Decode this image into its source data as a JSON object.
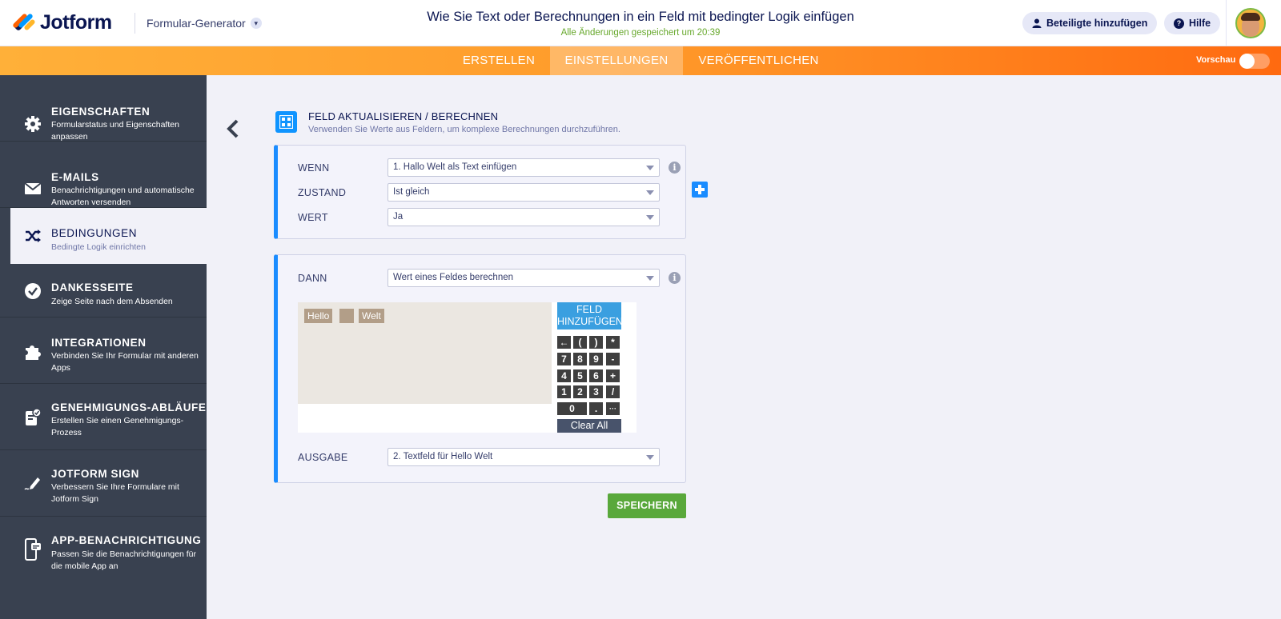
{
  "header": {
    "logo_text": "Jotform",
    "builder_label": "Formular-Generator",
    "form_title": "Wie Sie Text oder Berechnungen in ein Feld mit bedingter Logik einfügen",
    "saved_status": "Alle Änderungen gespeichert um 20:39",
    "add_participants": "Beteiligte hinzufügen",
    "help": "Hilfe"
  },
  "nav": {
    "tabs": [
      {
        "label": "ERSTELLEN",
        "active": false
      },
      {
        "label": "EINSTELLUNGEN",
        "active": true
      },
      {
        "label": "VERÖFFENTLICHEN",
        "active": false
      }
    ],
    "preview_label": "Vorschau",
    "preview_on": false
  },
  "sidebar": {
    "items": [
      {
        "title": "EIGENSCHAFTEN",
        "desc": "Formularstatus und Eigenschaften anpassen",
        "icon": "gear-icon"
      },
      {
        "title": "E-MAILS",
        "desc": "Benachrichtigungen und automatische Antworten versenden",
        "icon": "envelope-icon"
      },
      {
        "title": "BEDINGUNGEN",
        "desc": "Bedingte Logik einrichten",
        "icon": "shuffle-icon",
        "active": true
      },
      {
        "title": "DANKESSEITE",
        "desc": "Zeige Seite nach dem Absenden",
        "icon": "check-circle-icon"
      },
      {
        "title": "INTEGRATIONEN",
        "desc": "Verbinden Sie Ihr Formular mit anderen Apps",
        "icon": "puzzle-icon"
      },
      {
        "title": "GENEHMIGUNGS-ABLÄUFE",
        "desc": "Erstellen Sie einen Genehmigungs-Prozess",
        "icon": "approval-doc-icon"
      },
      {
        "title": "JOTFORM SIGN",
        "desc": "Verbessern Sie Ihre Formulare mit Jotform Sign",
        "icon": "pen-sign-icon"
      },
      {
        "title": "APP-BENACHRICHTIGUNG",
        "desc": "Passen Sie die Benachrichtigungen für die mobile App an",
        "icon": "mobile-notification-icon"
      }
    ]
  },
  "section": {
    "title": "FELD AKTUALISIEREN / BERECHNEN",
    "subtitle": "Verwenden Sie Werte aus Feldern, um komplexe Berechnungen durchzuführen."
  },
  "condition": {
    "if_label": "WENN",
    "if_value": "1. Hallo Welt als Text einfügen",
    "state_label": "ZUSTAND",
    "state_value": "Ist gleich",
    "value_label": "WERT",
    "value_value": "Ja"
  },
  "action": {
    "then_label": "DANN",
    "then_value": "Wert eines Feldes berechnen",
    "tokens": [
      "Hello",
      "",
      "Welt"
    ],
    "add_field": "FELD HINZUFÜGEN",
    "keypad": [
      "←",
      "(",
      ")",
      "*",
      "7",
      "8",
      "9",
      "-",
      "4",
      "5",
      "6",
      "+",
      "1",
      "2",
      "3",
      "/",
      "0",
      ".",
      "···"
    ],
    "clear_all": "Clear All",
    "output_label": "AUSGABE",
    "output_value": "2. Textfeld für Hello Welt"
  },
  "save_label": "SPEICHERN",
  "colors": {
    "accent_blue": "#1a8cff",
    "nav_orange": "#ff9a2a",
    "save_green": "#59a83b",
    "sidebar_bg": "#394150"
  }
}
